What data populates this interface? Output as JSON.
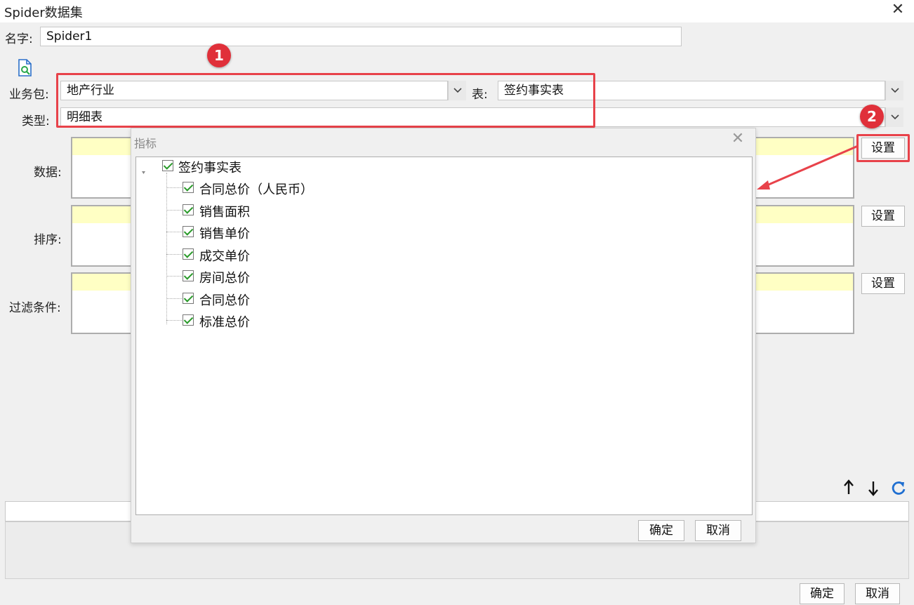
{
  "window": {
    "title": "Spider数据集",
    "close_symbol": "✕"
  },
  "name_field": {
    "label": "名字:",
    "value": "Spider1"
  },
  "preview_icon": "search-document-icon",
  "business_package": {
    "label": "业务包:",
    "value": "地产行业"
  },
  "table_field": {
    "label": "表:",
    "value": "签约事实表"
  },
  "type_field": {
    "label": "类型:",
    "value": "明细表"
  },
  "sections": {
    "data": {
      "label": "数据:",
      "button": "设置"
    },
    "sort": {
      "label": "排序:",
      "button": "设置"
    },
    "filter": {
      "label": "过滤条件:",
      "button": "设置"
    }
  },
  "annotations": {
    "marker1": "1",
    "marker2": "2",
    "highlight_color": "#e8424a"
  },
  "toolbar_icons": [
    "arrow-up-icon",
    "arrow-down-icon",
    "refresh-icon"
  ],
  "footer": {
    "confirm": "确定",
    "cancel": "取消"
  },
  "dialog": {
    "title": "指标",
    "close_symbol": "✕",
    "tree": {
      "root": "签约事实表",
      "children": [
        "合同总价（人民币）",
        "销售面积",
        "销售单价",
        "成交单价",
        "房间总价",
        "合同总价",
        "标准总价"
      ]
    },
    "confirm": "确定",
    "cancel": "取消"
  }
}
